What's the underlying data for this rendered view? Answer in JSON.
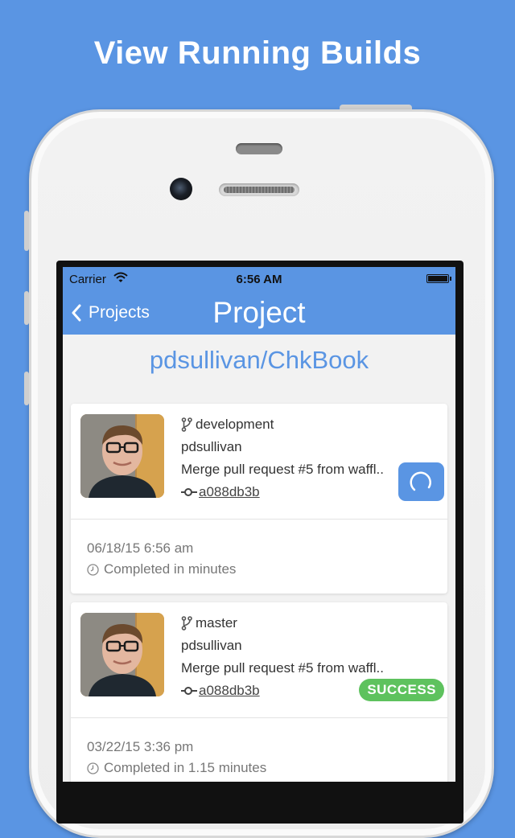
{
  "headline": "View Running Builds",
  "status_bar": {
    "carrier": "Carrier",
    "time": "6:56 AM"
  },
  "nav": {
    "back_label": "Projects",
    "title": "Project"
  },
  "repo": "pdsullivan/ChkBook",
  "builds": [
    {
      "branch": "development",
      "author": "pdsullivan",
      "message": "Merge pull request #5 from waffl..",
      "commit": "a088db3b",
      "date": "06/18/15 6:56 am",
      "status_text": "Completed in minutes",
      "state": "running"
    },
    {
      "branch": "master",
      "author": "pdsullivan",
      "message": "Merge pull request #5 from waffl..",
      "commit": "a088db3b",
      "date": "03/22/15 3:36 pm",
      "status_text": "Completed in 1.15 minutes",
      "state": "success",
      "badge": "SUCCESS"
    }
  ],
  "colors": {
    "accent": "#5a95e3",
    "success": "#5ec25e",
    "background": "#5a95e3"
  },
  "icons": [
    "wifi-icon",
    "battery-icon",
    "chevron-left-icon",
    "branch-icon",
    "commit-icon",
    "clock-icon",
    "spinner-icon"
  ]
}
